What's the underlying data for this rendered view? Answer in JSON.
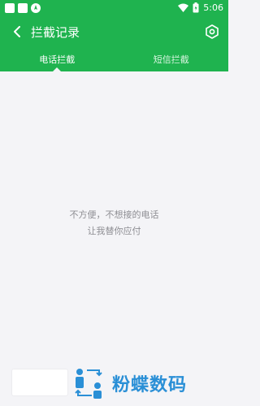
{
  "status_bar": {
    "time": "5:06",
    "icons": [
      "notification-square-icon",
      "notification-square-icon",
      "compass-icon",
      "wifi-icon",
      "battery-icon"
    ]
  },
  "toolbar": {
    "title": "拦截记录",
    "back_icon": "chevron-left-icon",
    "settings_icon": "gear-icon"
  },
  "tabs": [
    {
      "label": "电话拦截",
      "active": true
    },
    {
      "label": "短信拦截",
      "active": false
    }
  ],
  "empty_state": {
    "line1": "不方便，不想接的电话",
    "line2": "让我替你应付"
  },
  "watermark": {
    "text": "粉蝶数码"
  },
  "colors": {
    "primary": "#1fb34f",
    "background": "#f4f4f7",
    "empty_text": "#8e8e93",
    "watermark": "#2a8fd6"
  }
}
